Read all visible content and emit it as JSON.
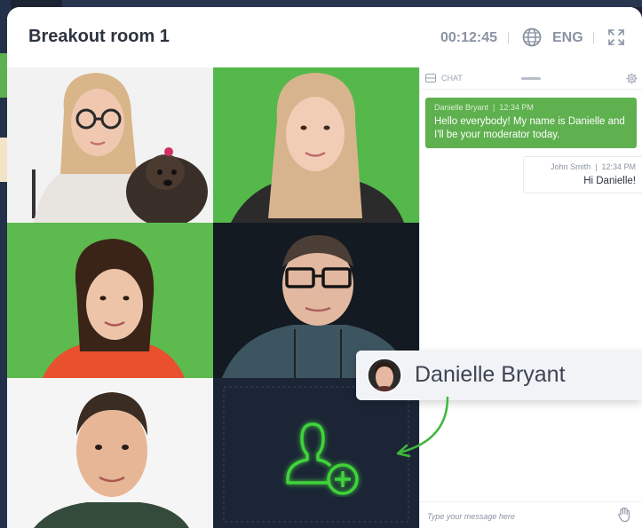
{
  "room": {
    "title": "Breakout room 1",
    "timer": "00:12:45",
    "language": "ENG"
  },
  "participants": [
    {
      "id": "p1",
      "background": "#f2f2f2"
    },
    {
      "id": "p2",
      "background": "#55b84b"
    },
    {
      "id": "p3",
      "background": "#5dba4e"
    },
    {
      "id": "p4",
      "background": "#141a22"
    },
    {
      "id": "p5",
      "background": "#f5f5f5"
    },
    {
      "id": "add",
      "background": "#1b2536"
    }
  ],
  "chat": {
    "label": "CHAT",
    "messages": [
      {
        "sender": "Danielle Bryant",
        "time": "12:34 PM",
        "text": "Hello everybody! My name is Danielle and I'll be your moderator today."
      },
      {
        "sender": "John Smith",
        "time": "12:34 PM",
        "text": "Hi Danielle!"
      }
    ],
    "input_placeholder": "Type your message here"
  },
  "name_tag": {
    "name": "Danielle Bryant"
  },
  "colors": {
    "accent_green": "#5fb04f",
    "add_icon_green": "#3fd33a",
    "dark_tile": "#1b2536"
  }
}
